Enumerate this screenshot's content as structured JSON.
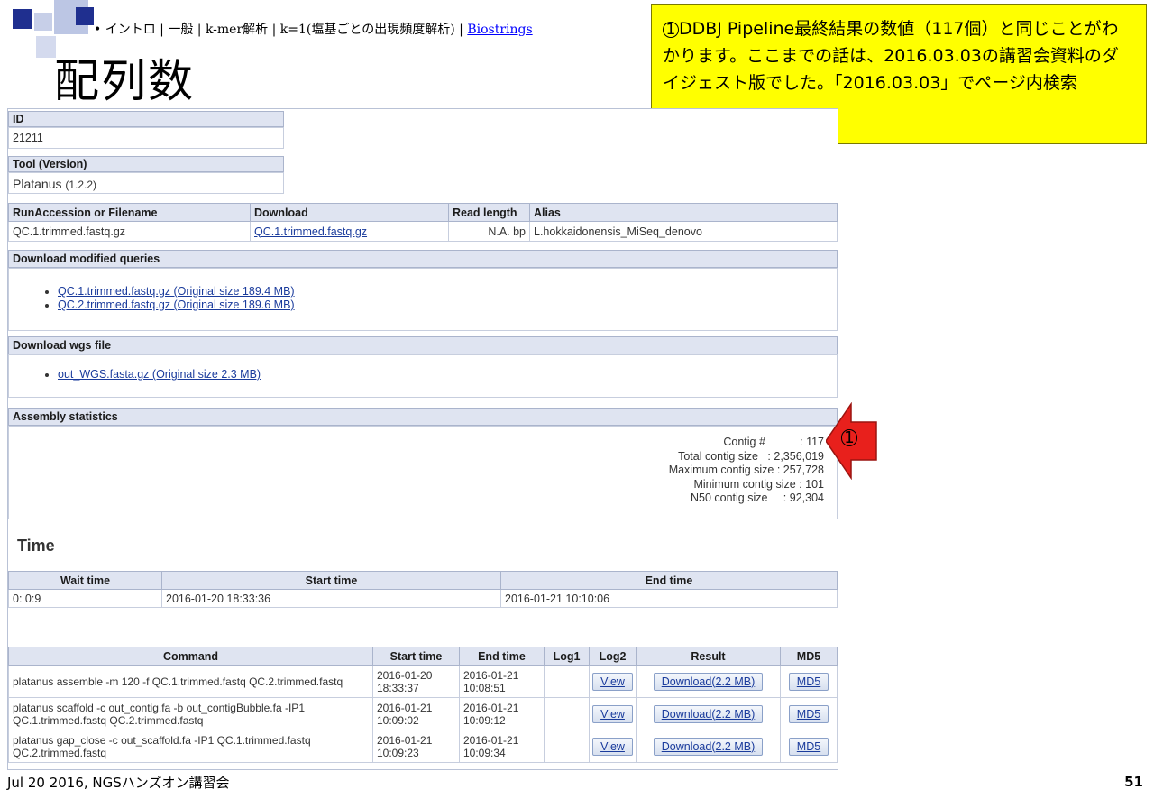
{
  "slide": {
    "breadcrumb_prefix": "• イントロ | 一般 | k-mer解析 | k=1(塩基ごとの出現頻度解析) | ",
    "breadcrumb_link": "Biostrings",
    "title": "配列数",
    "callout_marker": "1",
    "callout_text": "DDBJ Pipeline最終結果の数値（117個）と同じことがわかります。ここまでの話は、2016.03.03の講習会資料のダイジェスト版でした。「2016.03.03」でページ内検索",
    "arrow_marker": "1",
    "footer": "Jul 20 2016, NGSハンズオン講習会",
    "page_number": "51"
  },
  "job": {
    "id_label": "ID",
    "id_value": "21211",
    "tool_label": "Tool (Version)",
    "tool_name": "Platanus",
    "tool_version": "(1.2.2)",
    "run_headers": [
      "RunAccession or Filename",
      "Download",
      "Read length",
      "Alias"
    ],
    "run_row": {
      "file": "QC.1.trimmed.fastq.gz",
      "download": "QC.1.trimmed.fastq.gz",
      "read_length": "N.A. bp",
      "alias": "L.hokkaidonensis_MiSeq_denovo"
    },
    "modified_label": "Download modified queries",
    "modified_items": [
      "QC.1.trimmed.fastq.gz (Original size 189.4 MB)",
      "QC.2.trimmed.fastq.gz (Original size 189.6 MB)"
    ],
    "wgs_label": "Download wgs file",
    "wgs_items": [
      "out_WGS.fasta.gz (Original size 2.3 MB)"
    ],
    "assembly_label": "Assembly statistics",
    "stats": [
      "Contig #           : 117",
      "Total contig size   : 2,356,019",
      "Maximum contig size : 257,728",
      "Minimum contig size : 101",
      "N50 contig size     : 92,304"
    ],
    "time_heading": "Time",
    "time_headers": [
      "Wait time",
      "Start time",
      "End time"
    ],
    "time_row": [
      "0: 0:9",
      "2016-01-20 18:33:36",
      "2016-01-21 10:10:06"
    ],
    "cmd_headers": [
      "Command",
      "Start time",
      "End time",
      "Log1",
      "Log2",
      "Result",
      "MD5"
    ],
    "cmd_rows": [
      {
        "cmd": "platanus assemble -m 120 -f QC.1.trimmed.fastq QC.2.trimmed.fastq",
        "start": "2016-01-20 18:33:37",
        "end": "2016-01-21 10:08:51",
        "log1": "",
        "log2": "View",
        "result": "Download(2.2 MB)",
        "md5": "MD5"
      },
      {
        "cmd": "platanus scaffold -c out_contig.fa -b out_contigBubble.fa -IP1 QC.1.trimmed.fastq QC.2.trimmed.fastq",
        "start": "2016-01-21 10:09:02",
        "end": "2016-01-21 10:09:12",
        "log1": "",
        "log2": "View",
        "result": "Download(2.2 MB)",
        "md5": "MD5"
      },
      {
        "cmd": "platanus gap_close -c out_scaffold.fa -IP1 QC.1.trimmed.fastq QC.2.trimmed.fastq",
        "start": "2016-01-21 10:09:23",
        "end": "2016-01-21 10:09:34",
        "log1": "",
        "log2": "View",
        "result": "Download(2.2 MB)",
        "md5": "MD5"
      }
    ]
  },
  "colors": {
    "callout": "#ffff00",
    "header_bg": "#dfe4f1",
    "arrow": "#e8201c",
    "deco_square": "#1f2f8f"
  }
}
